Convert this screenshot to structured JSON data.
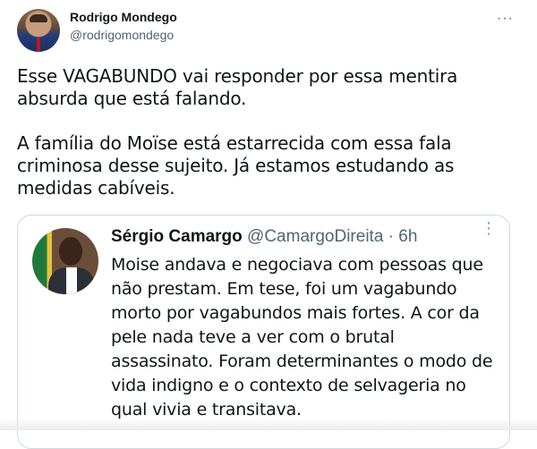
{
  "tweet": {
    "author_name": "Rodrigo Mondego",
    "author_handle": "@rodrigomondego",
    "more_label": "···",
    "paragraphs": [
      "Esse VAGABUNDO vai responder por essa mentira absurda que está falando.",
      "A família do Moïse está estarrecida com essa fala criminosa desse sujeito. Já estamos estudando as medidas cabíveis."
    ]
  },
  "quote": {
    "author_name": "Sérgio Camargo",
    "author_handle": "@CamargoDireita",
    "separator": "·",
    "time": "6h",
    "more_label": "⋮",
    "text": "Moise andava e negociava com pessoas que não prestam. Em tese, foi um vagabundo morto por vagabundos mais fortes. A cor da pele nada teve a ver com o brutal assassinato. Foram determinantes o modo de vida indigno e o contexto de selvageria no qual vivia e transitava."
  },
  "colors": {
    "primary_text": "#0f1419",
    "secondary_text": "#536471",
    "border": "#cfd9de"
  },
  "icons": {
    "tweet_more": "more-horizontal-icon",
    "quote_more": "more-vertical-icon"
  }
}
